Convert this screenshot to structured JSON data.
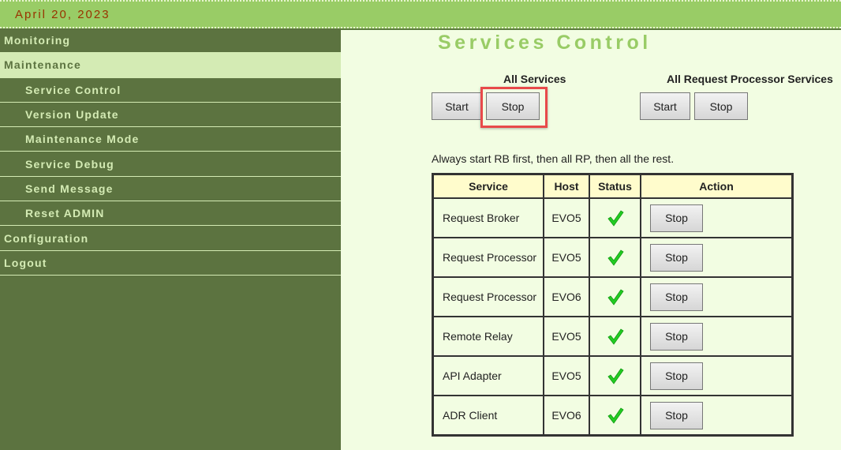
{
  "header": {
    "date": "April 20, 2023"
  },
  "sidebar": {
    "items": [
      {
        "label": "Monitoring",
        "level": 1,
        "active": false
      },
      {
        "label": "Maintenance",
        "level": 1,
        "active": true
      },
      {
        "label": "Service Control",
        "level": 2,
        "active": false
      },
      {
        "label": "Version Update",
        "level": 2,
        "active": false
      },
      {
        "label": "Maintenance Mode",
        "level": 2,
        "active": false
      },
      {
        "label": "Service Debug",
        "level": 2,
        "active": false
      },
      {
        "label": "Send Message",
        "level": 2,
        "active": false
      },
      {
        "label": "Reset ADMIN",
        "level": 2,
        "active": false
      },
      {
        "label": "Configuration",
        "level": 1,
        "active": false
      },
      {
        "label": "Logout",
        "level": 1,
        "active": false
      }
    ]
  },
  "main": {
    "title": "Services Control",
    "all_services": {
      "label": "All Services",
      "start": "Start",
      "stop": "Stop"
    },
    "all_rp_services": {
      "label": "All Request Processor Services",
      "start": "Start",
      "stop": "Stop"
    },
    "note": "Always start RB first, then all RP, then all the rest.",
    "table": {
      "headers": [
        "Service",
        "Host",
        "Status",
        "Action"
      ],
      "rows": [
        {
          "service": "Request Broker",
          "host": "EVO5",
          "status": "running",
          "action": "Stop"
        },
        {
          "service": "Request Processor",
          "host": "EVO5",
          "status": "running",
          "action": "Stop"
        },
        {
          "service": "Request Processor",
          "host": "EVO6",
          "status": "running",
          "action": "Stop"
        },
        {
          "service": "Remote Relay",
          "host": "EVO5",
          "status": "running",
          "action": "Stop"
        },
        {
          "service": "API Adapter",
          "host": "EVO5",
          "status": "running",
          "action": "Stop"
        },
        {
          "service": "ADR Client",
          "host": "EVO6",
          "status": "running",
          "action": "Stop"
        }
      ]
    }
  },
  "colors": {
    "accent": "#99cc66",
    "sidebar_bg": "#5c7340",
    "highlight": "#e84a4a",
    "check": "#22cc22"
  }
}
